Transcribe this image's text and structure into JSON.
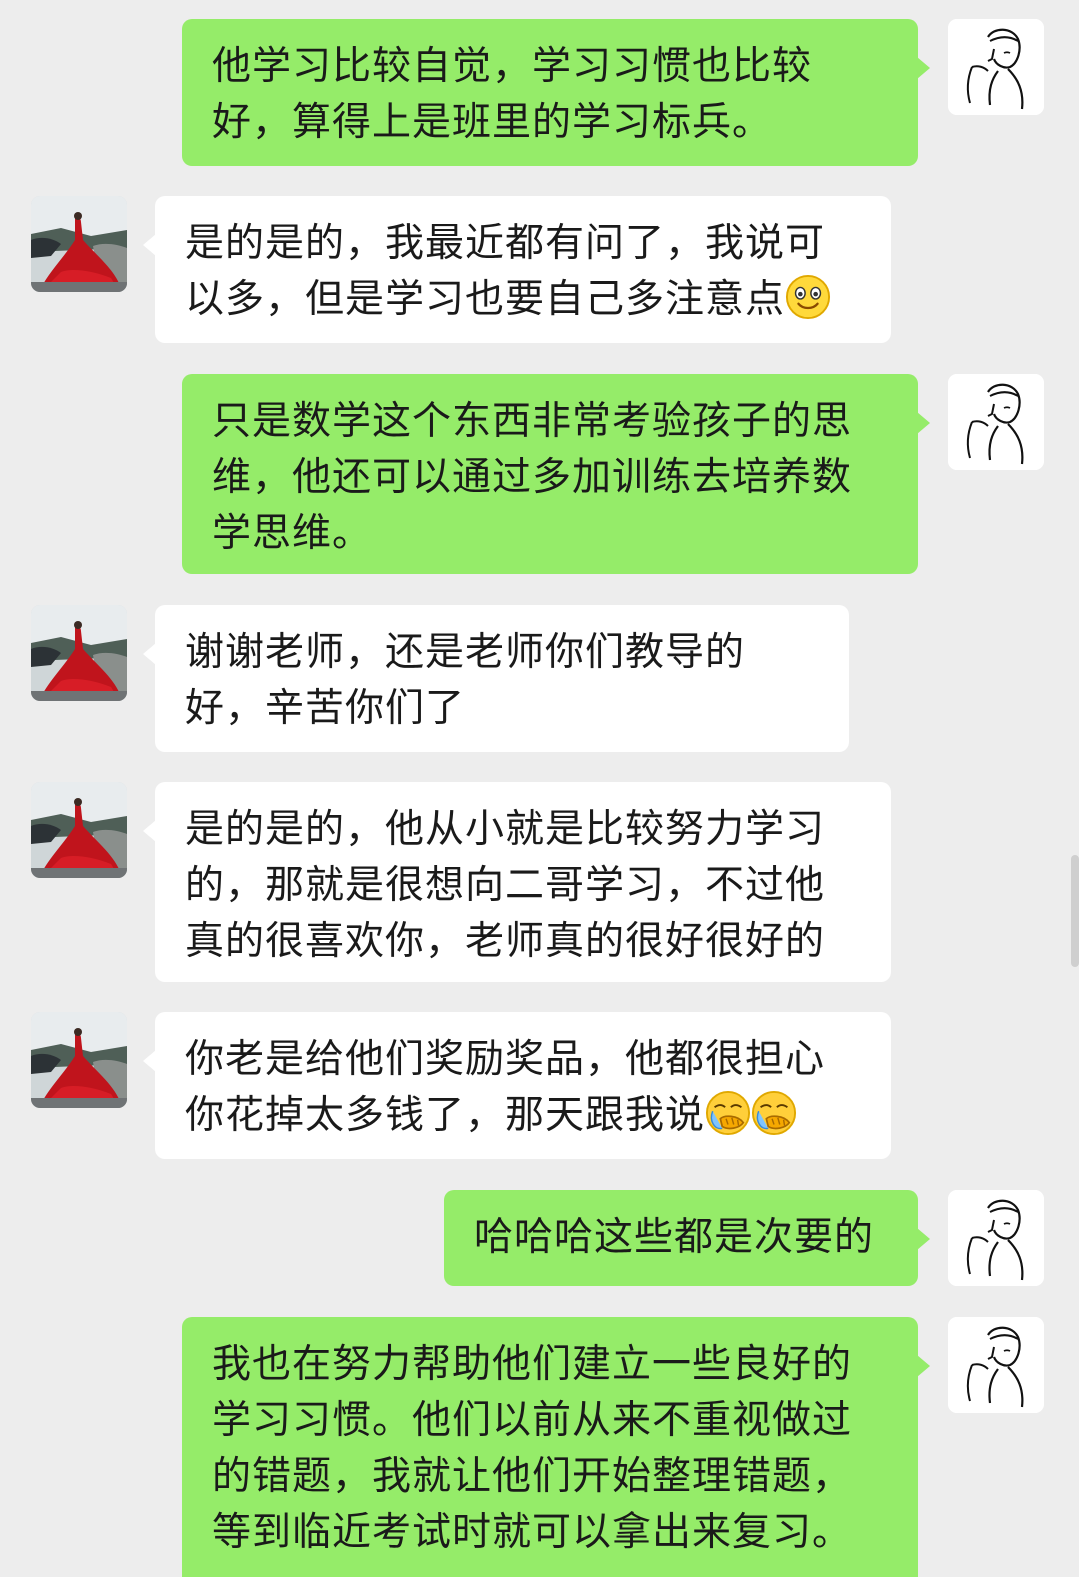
{
  "messages": [
    {
      "side": "self",
      "text": "他学习比较自觉，学习习惯也比较好，算得上是班里的学习标兵。"
    },
    {
      "side": "peer",
      "text": "是的是的，我最近都有问了，我说可以多，但是学习也要自己多注意点",
      "emoji": "smile-emoji"
    },
    {
      "side": "self",
      "text": "只是数学这个东西非常考验孩子的思维，他还可以通过多加训练去培养数学思维。"
    },
    {
      "side": "peer",
      "text": "谢谢老师，还是老师你们教导的好，辛苦你们了"
    },
    {
      "side": "peer",
      "text": "是的是的，他从小就是比较努力学习的，那就是很想向二哥学习，不过他真的很喜欢你，老师真的很好很好的"
    },
    {
      "side": "peer",
      "text": "你老是给他们奖励奖品，他都很担心你花掉太多钱了，那天跟我说",
      "emoji": "facepalm-emoji x2"
    },
    {
      "side": "self",
      "text": "哈哈哈这些都是次要的"
    },
    {
      "side": "self",
      "text": "我也在努力帮助他们建立一些良好的学习习惯。他们以前从来不重视做过的错题，我就让他们开始整理错题，等到临近考试时就可以拿出来复习。"
    }
  ],
  "colors": {
    "background": "#ededed",
    "self_bubble": "#95ec69",
    "peer_bubble": "#ffffff"
  },
  "icons": {
    "self_avatar": "sketch-boy-avatar",
    "peer_avatar": "red-dress-photo-avatar"
  }
}
